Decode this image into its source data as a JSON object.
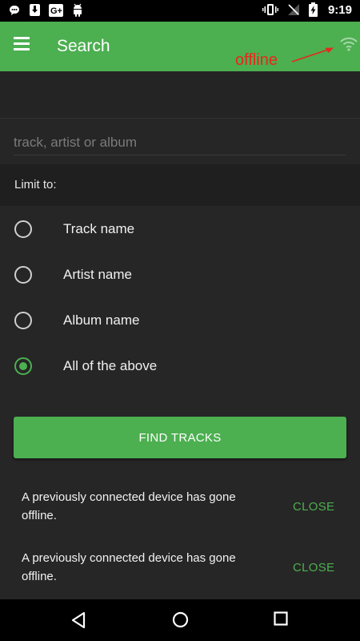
{
  "status_bar": {
    "time": "9:19",
    "left_icons": [
      "chat-bubble-icon",
      "download-icon",
      "google-plus-icon",
      "android-icon"
    ],
    "right_icons": [
      "vibrate-icon",
      "no-signal-icon",
      "battery-charging-icon"
    ]
  },
  "app_bar": {
    "title": "Search",
    "menu_icon": "hamburger-menu-icon",
    "status_icon": "wifi-icon",
    "annotation": "offline"
  },
  "search": {
    "placeholder": "track, artist or album",
    "value": ""
  },
  "limit": {
    "label": "Limit to:",
    "options": [
      {
        "label": "Track name",
        "selected": false
      },
      {
        "label": "Artist name",
        "selected": false
      },
      {
        "label": "Album name",
        "selected": false
      },
      {
        "label": "All of the above",
        "selected": true
      }
    ]
  },
  "find_button": {
    "label": "FIND TRACKS"
  },
  "snackbars": [
    {
      "message": "A previously connected device has gone offline.",
      "action": "CLOSE"
    },
    {
      "message": "A previously connected device has gone offline.",
      "action": "CLOSE"
    }
  ],
  "colors": {
    "accent": "#4caf50",
    "background": "#262626",
    "annotation": "#e8271b"
  }
}
